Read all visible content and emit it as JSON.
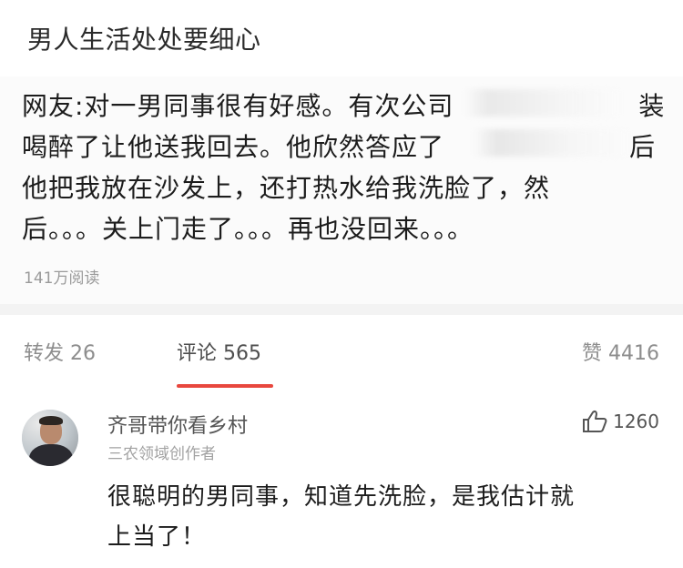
{
  "header": {
    "title": "男人生活处处要细心"
  },
  "post": {
    "lines": [
      "网友:对一男同事很有好感。有次公司　　　　　　　装",
      "喝醉了让他送我回去。他欣然答应了　　　　　　　后",
      "他把我放在沙发上，还打热水给我洗脸了，然",
      "后。。。关上门走了。。。再也没回来。。。"
    ],
    "reads": "141万阅读"
  },
  "tabs": {
    "repost": "转发 26",
    "comments": "评论 565",
    "likes": "赞 4416"
  },
  "comment": {
    "name": "齐哥带你看乡村",
    "tag": "三农领域创作者",
    "likes": "1260",
    "lines": [
      "很聪明的男同事，知道先洗脸，是我估计就",
      "上当了！"
    ]
  },
  "colors": {
    "accent": "#e8473e",
    "muted": "#9a9a9a"
  },
  "icons": {
    "like": "thumbs-up-icon",
    "avatar": "user-avatar"
  }
}
